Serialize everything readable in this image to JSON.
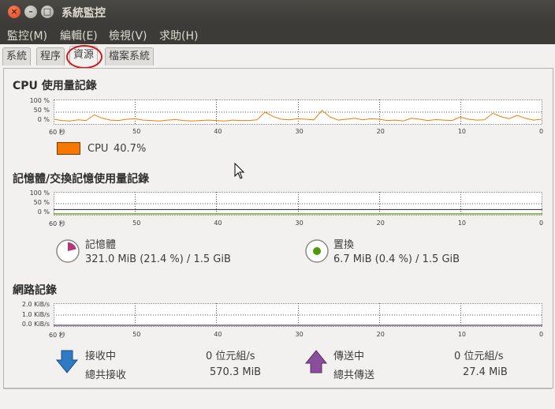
{
  "window": {
    "title": "系統監控",
    "close_glyph": "×",
    "min_glyph": "–",
    "max_glyph": "□"
  },
  "menubar": [
    {
      "label": "監控(M)"
    },
    {
      "label": "編輯(E)"
    },
    {
      "label": "檢視(V)"
    },
    {
      "label": "求助(H)"
    }
  ],
  "tabs": [
    {
      "label": "系統",
      "active": false
    },
    {
      "label": "程序",
      "active": false
    },
    {
      "label": "資源",
      "active": true
    },
    {
      "label": "檔案系統",
      "active": false
    }
  ],
  "cpu": {
    "title": "CPU 使用量記錄",
    "y_ticks": [
      "100 %",
      "50 %",
      "0 %"
    ],
    "x_ticks": [
      "60 秒",
      "50",
      "40",
      "30",
      "20",
      "10",
      "0"
    ],
    "legend_label": "CPU",
    "legend_value": "40.7%",
    "color": "#f57900"
  },
  "memory": {
    "title": "記憶體/交換記憶使用量記錄",
    "y_ticks": [
      "100 %",
      "50 %",
      "0 %"
    ],
    "x_ticks": [
      "60 秒",
      "50",
      "40",
      "30",
      "20",
      "10",
      "0"
    ],
    "mem_label": "記憶體",
    "mem_value": "321.0 MiB (21.4 %) / 1.5 GiB",
    "mem_percent": 21.4,
    "mem_color": "#b4357a",
    "swap_label": "置換",
    "swap_value": "6.7 MiB (0.4 %) / 1.5 GiB",
    "swap_percent": 0.4,
    "swap_color": "#4e9a06"
  },
  "network": {
    "title": "網路記錄",
    "y_ticks": [
      "2.0 KiB/s",
      "1.0 KiB/s",
      "0.0 KiB/s"
    ],
    "x_ticks": [
      "60 秒",
      "50",
      "40",
      "30",
      "20",
      "10",
      "0"
    ],
    "recv_label": "接收中",
    "recv_rate": "0 位元組/s",
    "recv_total_label": "總共接收",
    "recv_total": "570.3 MiB",
    "recv_color": "#2e7bc4",
    "send_label": "傳送中",
    "send_rate": "0 位元組/s",
    "send_total_label": "總共傳送",
    "send_total": "27.4 MiB",
    "send_color": "#75507b"
  },
  "chart_data": [
    {
      "type": "line",
      "x": [
        60,
        59,
        58,
        57,
        56,
        55,
        54,
        53,
        52,
        51,
        50,
        49,
        48,
        47,
        46,
        45,
        44,
        43,
        42,
        41,
        40,
        39,
        38,
        37,
        36,
        35,
        34,
        33,
        32,
        31,
        30,
        29,
        28,
        27,
        26,
        25,
        24,
        23,
        22,
        21,
        20,
        19,
        18,
        17,
        16,
        15,
        14,
        13,
        12,
        11,
        10,
        9,
        8,
        7,
        6,
        5,
        4,
        3,
        2,
        1,
        0
      ],
      "series": [
        {
          "name": "CPU",
          "values": [
            18,
            12,
            10,
            15,
            12,
            38,
            22,
            14,
            12,
            18,
            20,
            14,
            12,
            10,
            14,
            16,
            12,
            10,
            12,
            14,
            12,
            10,
            14,
            12,
            12,
            15,
            50,
            30,
            18,
            15,
            20,
            18,
            15,
            58,
            28,
            14,
            18,
            22,
            15,
            20,
            18,
            12,
            14,
            10,
            22,
            18,
            12,
            16,
            14,
            12,
            28,
            18,
            14,
            15,
            45,
            30,
            20,
            35,
            22,
            14,
            18
          ]
        }
      ],
      "xlim": [
        60,
        0
      ],
      "ylim": [
        0,
        100
      ]
    },
    {
      "type": "line",
      "x": [
        60,
        0
      ],
      "series": [
        {
          "name": "記憶體",
          "values": [
            21.4,
            21.4
          ]
        },
        {
          "name": "置換",
          "values": [
            0.4,
            0.4
          ]
        }
      ],
      "xlim": [
        60,
        0
      ],
      "ylim": [
        0,
        100
      ]
    },
    {
      "type": "line",
      "x": [
        60,
        0
      ],
      "series": [
        {
          "name": "接收中",
          "values": [
            0,
            0
          ]
        },
        {
          "name": "傳送中",
          "values": [
            0,
            0
          ]
        }
      ],
      "xlim": [
        60,
        0
      ],
      "ylim": [
        0,
        2.0
      ]
    }
  ]
}
